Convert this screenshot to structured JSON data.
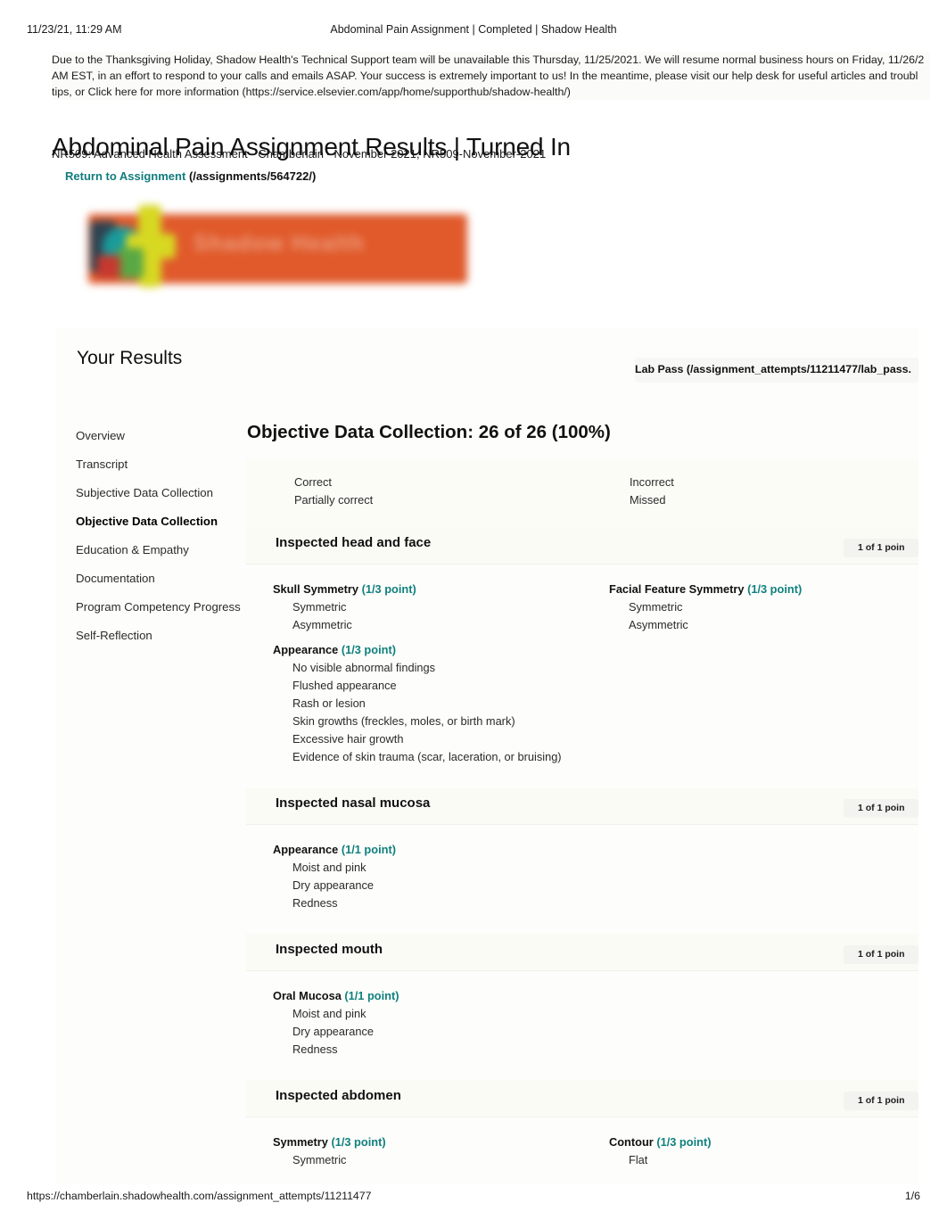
{
  "print_header": {
    "date": "11/23/21, 11:29 AM",
    "title": "Abdominal Pain Assignment | Completed | Shadow Health"
  },
  "notice": {
    "text": "Due to the Thanksgiving Holiday, Shadow Health's Technical Support team will be unavailable this Thursday, 11/25/2021. We will resume normal business hours on Friday, 11/26/2 AM EST, in an effort to respond to your calls and emails ASAP. Your success is extremely important to us! In the meantime, please visit our help desk for useful articles and troubl tips, or Click here for more information (https://service.elsevier.com/app/home/supporthub/shadow-health/)"
  },
  "header": {
    "title": "Abdominal Pain Assignment Results | Turned In",
    "subtitle": "NR509: Advanced Health Assessment - Chamberlain - November 2021, NR509-November-2021",
    "return_link_label": "Return to Assignment",
    "return_link_url": "(/assignments/564722/)",
    "logo_text": "Shadow Health"
  },
  "results": {
    "heading": "Your Results",
    "lab_pass": "Lab Pass (/assignment_attempts/11211477/lab_pass."
  },
  "sidebar": {
    "items": [
      {
        "label": "Overview",
        "active": false
      },
      {
        "label": "Transcript",
        "active": false
      },
      {
        "label": "Subjective Data Collection",
        "active": false
      },
      {
        "label": "Objective Data Collection",
        "active": true
      },
      {
        "label": "Education & Empathy",
        "active": false
      },
      {
        "label": "Documentation",
        "active": false
      },
      {
        "label": "Program Competency Progress",
        "active": false
      },
      {
        "label": "Self-Reflection",
        "active": false
      }
    ]
  },
  "main": {
    "heading": "Objective Data Collection: 26 of 26 (100%)",
    "legend": {
      "left": [
        "Correct",
        "Partially correct"
      ],
      "right": [
        "Incorrect",
        "Missed"
      ]
    },
    "sections": [
      {
        "title": "Inspected head and face",
        "score": "1 of 1 poin",
        "questions": [
          {
            "title": "Skull Symmetry",
            "points": "(1/3 point)",
            "width": "half",
            "options": [
              "Symmetric",
              "Asymmetric"
            ]
          },
          {
            "title": "Facial Feature Symmetry",
            "points": "(1/3 point)",
            "width": "half",
            "options": [
              "Symmetric",
              "Asymmetric"
            ]
          },
          {
            "title": "Appearance",
            "points": "(1/3 point)",
            "width": "full",
            "options": [
              "No visible abnormal findings",
              "Flushed appearance",
              "Rash or lesion",
              "Skin growths (freckles, moles, or birth mark)",
              "Excessive hair growth",
              "Evidence of skin trauma (scar, laceration, or bruising)"
            ]
          }
        ]
      },
      {
        "title": "Inspected nasal mucosa",
        "score": "1 of 1 poin",
        "questions": [
          {
            "title": "Appearance",
            "points": "(1/1 point)",
            "width": "full",
            "options": [
              "Moist and pink",
              "Dry appearance",
              "Redness"
            ]
          }
        ]
      },
      {
        "title": "Inspected mouth",
        "score": "1 of 1 poin",
        "questions": [
          {
            "title": "Oral Mucosa",
            "points": "(1/1 point)",
            "width": "full",
            "options": [
              "Moist and pink",
              "Dry appearance",
              "Redness"
            ]
          }
        ]
      },
      {
        "title": "Inspected abdomen",
        "score": "1 of 1 poin",
        "questions": [
          {
            "title": "Symmetry",
            "points": "(1/3 point)",
            "width": "half",
            "options": [
              "Symmetric"
            ]
          },
          {
            "title": "Contour",
            "points": "(1/3 point)",
            "width": "half",
            "options": [
              "Flat"
            ]
          }
        ]
      }
    ]
  },
  "print_footer": {
    "url": "https://chamberlain.shadowhealth.com/assignment_attempts/11211477",
    "page": "1/6"
  },
  "colors": {
    "accent_teal": "#10807e",
    "logo_orange": "#e05a2b"
  }
}
